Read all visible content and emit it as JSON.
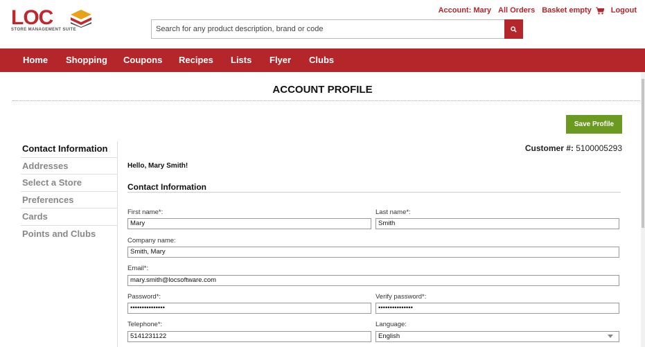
{
  "brand": {
    "name": "LOC",
    "tagline": "Store Management Suite",
    "color": "#c0282d"
  },
  "header": {
    "search_placeholder": "Search for any product description, brand or code",
    "links": {
      "account": "Account: Mary",
      "orders": "All Orders",
      "basket": "Basket empty",
      "logout": "Logout"
    }
  },
  "nav": [
    "Home",
    "Shopping",
    "Coupons",
    "Recipes",
    "Lists",
    "Flyer",
    "Clubs"
  ],
  "page": {
    "title": "ACCOUNT PROFILE",
    "save_label": "Save Profile",
    "accent": "#b5262b",
    "save_color": "#6a9a1f"
  },
  "sidebar": [
    "Contact Information",
    "Addresses",
    "Select a Store",
    "Preferences",
    "Cards",
    "Points and Clubs"
  ],
  "customer": {
    "label": "Customer #:",
    "number": "5100005293"
  },
  "greeting": "Hello, Mary Smith!",
  "section_title": "Contact Information",
  "form": {
    "first_name": {
      "label": "First name*:",
      "value": "Mary"
    },
    "last_name": {
      "label": "Last name*:",
      "value": "Smith"
    },
    "company": {
      "label": "Company name:",
      "value": "Smith, Mary"
    },
    "email": {
      "label": "Email*:",
      "value": "mary.smith@locsoftware.com"
    },
    "password": {
      "label": "Password*:",
      "value": "•••••••••••••••"
    },
    "verify_password": {
      "label": "Verify password*:",
      "value": "•••••••••••••••"
    },
    "telephone": {
      "label": "Telephone*:",
      "value": "5141231122"
    },
    "language": {
      "label": "Language:",
      "value": "English"
    }
  }
}
